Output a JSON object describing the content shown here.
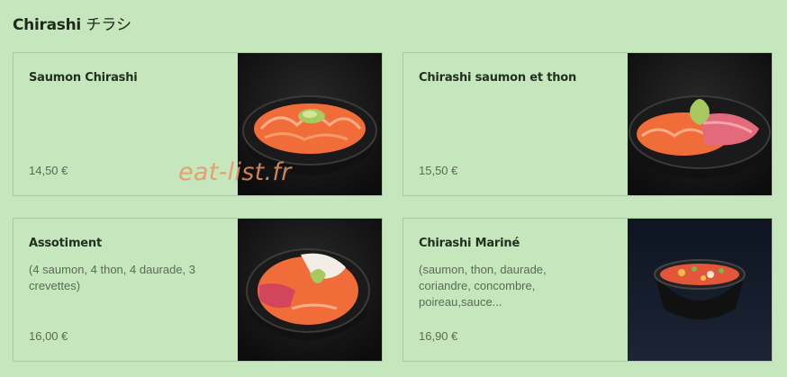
{
  "section": {
    "title_latin": "Chirashi",
    "title_japanese": "チラシ"
  },
  "items": [
    {
      "name": "Saumon Chirashi",
      "description": "",
      "price": "14,50 €",
      "image": "salmon-chirashi-bowl"
    },
    {
      "name": "Chirashi saumon et thon",
      "description": "",
      "price": "15,50 €",
      "image": "salmon-tuna-chirashi-bowl"
    },
    {
      "name": "Assotiment",
      "description": "(4 saumon, 4 thon, 4 daurade, 3 crevettes)",
      "price": "16,00 €",
      "image": "assorted-chirashi-bowl"
    },
    {
      "name": "Chirashi Mariné",
      "description": "(saumon, thon, daurade, coriandre, concombre, poireau,sauce...",
      "price": "16,90 €",
      "image": "marinated-chirashi-bowl"
    }
  ],
  "watermark": "eat-list.fr",
  "colors": {
    "background": "#c6e6bd",
    "card_border": "#a9cba0",
    "title_text": "#1f2a1c",
    "muted_text": "#5a6b56",
    "watermark": "#e9965f"
  }
}
